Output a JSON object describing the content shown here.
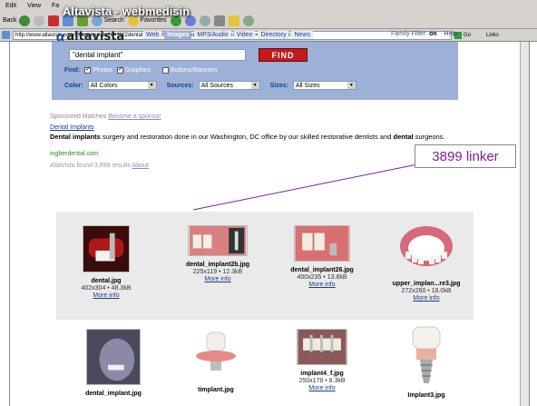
{
  "slide": {
    "title": "Altavista - webmedisin"
  },
  "browser": {
    "menu": [
      "Edit",
      "View",
      "Fa"
    ],
    "toolbar": {
      "back": "Back",
      "search": "Search",
      "favorites": "Favorites"
    },
    "address": "http://www.altavista.com/image/results?q=%22dental+implant%22&ei=photos&mmi=graphics&mmb=all&sc=all&sz=all",
    "go": "Go",
    "links": "Links"
  },
  "altavista": {
    "logo_text": "altavista",
    "tabs": [
      "Web",
      "Images",
      "MP3/Audio",
      "Video",
      "Directory",
      "News"
    ],
    "active_tab": "Images",
    "family_filter_label": "Family Filter:",
    "family_filter_value": "on",
    "help": "Help",
    "query": "\"dental implant\"",
    "find": "FIND",
    "find_label": "Find:",
    "find_options": [
      {
        "label": "Photos",
        "checked": true
      },
      {
        "label": "Graphics",
        "checked": true
      },
      {
        "label": "Buttons/Banners",
        "checked": false
      }
    ],
    "color_label": "Color:",
    "color_value": "All Colors",
    "sources_label": "Sources:",
    "sources_value": "All Sources",
    "sizes_label": "Sizes:",
    "sizes_value": "All Sizes"
  },
  "sponsored": {
    "heading": "Sponsored Matches",
    "become": "Become a sponsor",
    "link": "Dental Implants",
    "desc_bold": "Dental implants",
    "desc": " surgery and restoration done in our Washington, DC office by our skilled restorative dentists and ",
    "desc_bold2": "dental",
    "desc_end": " surgeons.",
    "url": "ingberdental.com"
  },
  "found": {
    "text": "AltaVista found 3,899 results",
    "about": "About"
  },
  "callout": "3899 linker",
  "results": [
    {
      "name": "dental.jpg",
      "dims": "402x304 • 48.3kB",
      "more": "More info"
    },
    {
      "name": "dental_implant2b.jpg",
      "dims": "225x119 • 12.3kB",
      "more": "More info"
    },
    {
      "name": "dental_implant26.jpg",
      "dims": "400x235 • 13.8kB",
      "more": "More info"
    },
    {
      "name": "upper_implan...re3.jpg",
      "dims": "272x260 • 16.0kB",
      "more": "More info"
    },
    {
      "name": "dental_implant.jpg",
      "dims": "",
      "more": ""
    },
    {
      "name": "timplant.jpg",
      "dims": "",
      "more": ""
    },
    {
      "name": "implant4_f.jpg",
      "dims": "250x178 • 8.3kB",
      "more": "More info"
    },
    {
      "name": "Implant3.jpg",
      "dims": "",
      "more": ""
    }
  ],
  "colors": {
    "brand_blue": "#1a3e8c",
    "panel_blue": "#9db0d8",
    "find_red": "#c31b1b",
    "callout_purple": "#7a1fa2"
  }
}
